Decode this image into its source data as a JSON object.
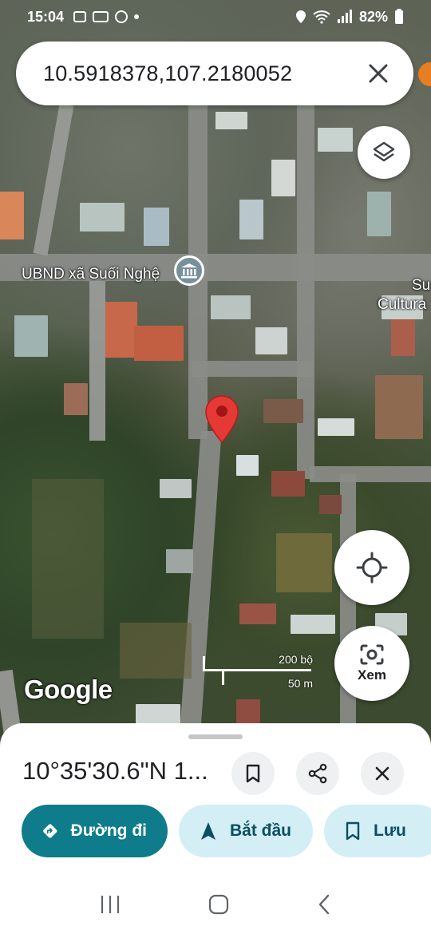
{
  "status_bar": {
    "time": "15:04",
    "battery": "82%",
    "notification_icons": [
      "gallery-icon",
      "zalo-icon",
      "messenger-icon",
      "dot-icon"
    ],
    "system_icons": [
      "location-icon",
      "wifi-icon",
      "signal-icon",
      "battery-icon"
    ]
  },
  "search": {
    "coordinates": "10.5918378,107.2180052",
    "close_icon": "close-icon"
  },
  "map": {
    "poi_label": "UBND xã Suối Nghệ",
    "edge_label_line1": "Su",
    "edge_label_line2": "Cultura",
    "google_logo": "Google",
    "scale_ft": "200 bộ",
    "scale_m": "50 m",
    "pin_color": "#e53935"
  },
  "fabs": {
    "layers_icon": "layers-icon",
    "locate_icon": "my-location-icon",
    "xem_label": "Xem",
    "xem_icon": "camera-search-icon"
  },
  "sheet": {
    "title": "10°35'30.6\"N 1...",
    "buttons": [
      "bookmark-icon",
      "share-icon",
      "close-icon"
    ],
    "chips": {
      "directions": "Đường đi",
      "start": "Bắt đầu",
      "save": "Lưu"
    },
    "accent": "#0e7c8a"
  },
  "navbar": {
    "icons": [
      "recent-apps-icon",
      "home-icon",
      "back-icon"
    ]
  }
}
